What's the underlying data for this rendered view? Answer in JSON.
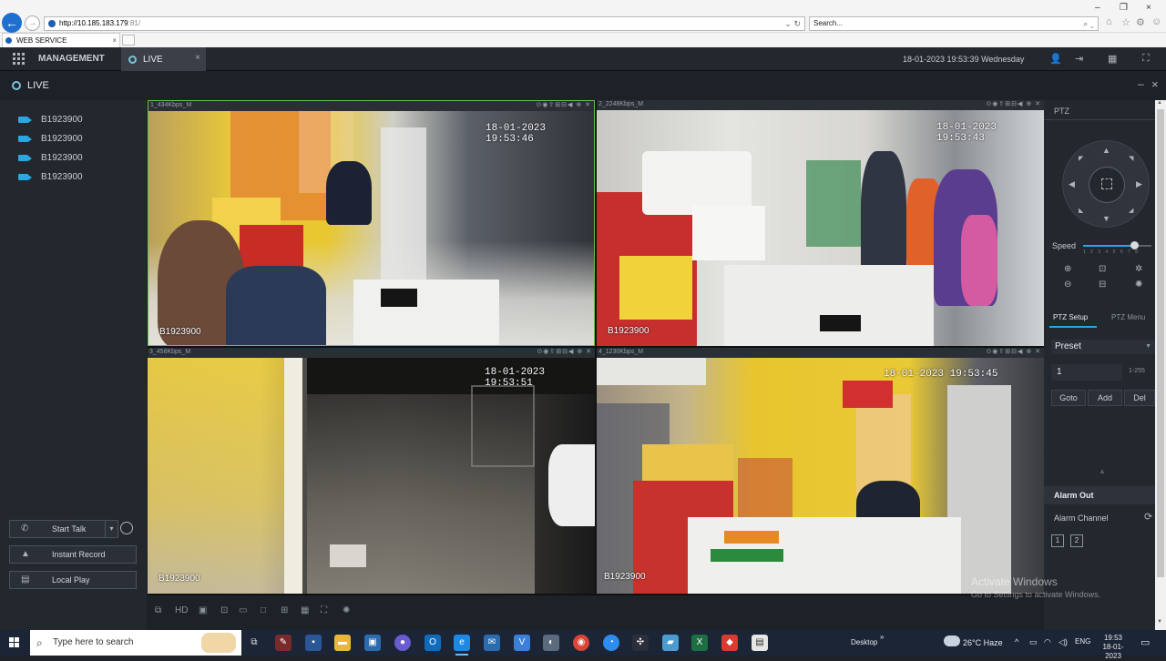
{
  "browser": {
    "url_host": "http://10.185.183.179",
    "url_port": ":81/",
    "search_placeholder": "Search...",
    "tab_title": "WEB SERVICE",
    "tab_close": "×",
    "window_controls": [
      "–",
      "❐",
      "×"
    ]
  },
  "app": {
    "nav_management": "MANAGEMENT",
    "tab_live": "LIVE",
    "tab_close": "×",
    "datetime": "18-01-2023 19:53:39 Wednesday",
    "page_title": "LIVE",
    "icons": [
      "user-icon",
      "logout-icon",
      "layout-icon",
      "fullscreen-icon"
    ]
  },
  "left_panel": {
    "devices": [
      "B1923900",
      "B1923900",
      "B1923900",
      "B1923900"
    ],
    "start_talk": "Start Talk",
    "instant_record": "Instant Record",
    "local_play": "Local Play"
  },
  "video": {
    "tiles": [
      {
        "kbps": "1_434Kbps_M",
        "timestamp": "18-01-2023 19:53:46",
        "osd": "B1923900"
      },
      {
        "kbps": "2_2248Kbps_M",
        "timestamp": "18-01-2023 19:53:43",
        "osd": "B1923900"
      },
      {
        "kbps": "3_458Kbps_M",
        "timestamp": "18-01-2023 19:53:51",
        "osd": "B1923900"
      },
      {
        "kbps": "4_1230Kbps_M",
        "timestamp": "18-01-2023 19:53:45",
        "osd": "B1923900"
      }
    ],
    "toolbar": {
      "hd_label": "HD"
    }
  },
  "ptz": {
    "title": "PTZ",
    "speed_label": "Speed",
    "speed_level": 0.75,
    "speed_ticks": "1 2 3 4 5 6 7 8",
    "tab_setup": "PTZ Setup",
    "tab_menu": "PTZ Menu",
    "preset_select": "Preset",
    "preset_value": "1",
    "preset_range": "1-255",
    "btn_goto": "Goto",
    "btn_add": "Add",
    "btn_del": "Del",
    "alarm_out": "Alarm Out",
    "alarm_channel": "Alarm Channel",
    "alarm_channels": [
      "1",
      "2"
    ]
  },
  "watermark": {
    "line1": "Activate Windows",
    "line2": "Go to Settings to activate Windows."
  },
  "taskbar": {
    "search_placeholder": "Type here to search",
    "desktop_label": "Desktop",
    "temperature": "26°C",
    "weather": "Haze",
    "language": "ENG",
    "time": "19:53",
    "date": "18-01-2023"
  },
  "colors": {
    "accent": "#2aa6e0",
    "selected_tile_border": "#6bc24a",
    "panel_bg": "#23272e"
  }
}
